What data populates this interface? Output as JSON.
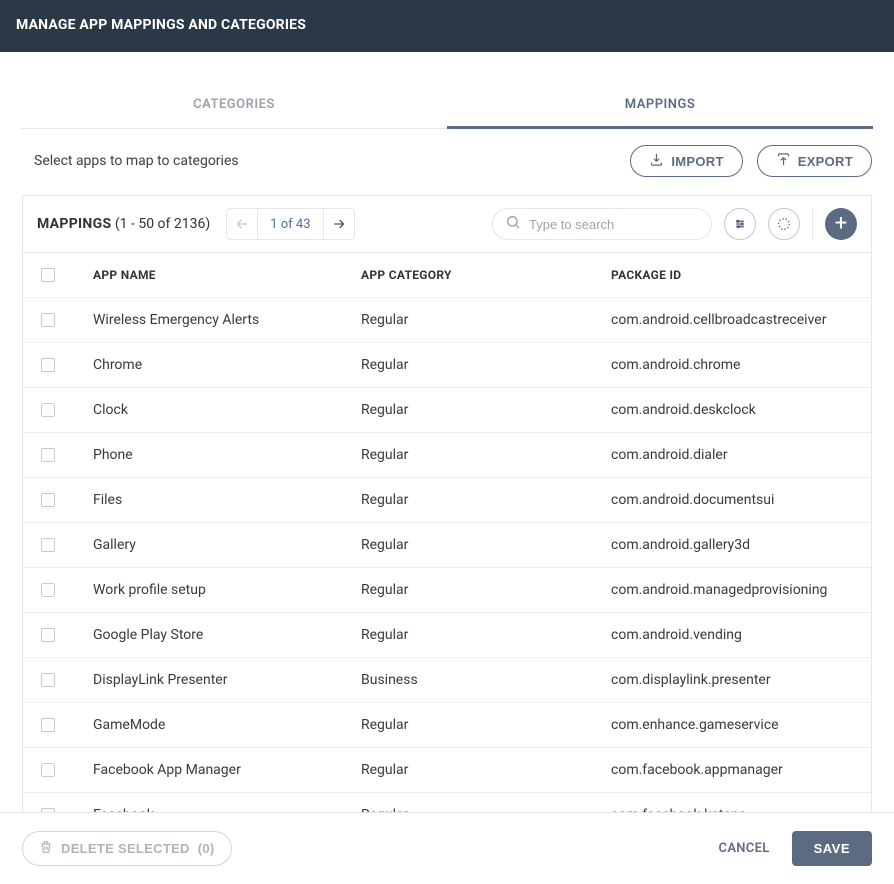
{
  "header": {
    "title": "MANAGE APP MAPPINGS AND CATEGORIES"
  },
  "tabs": {
    "categories": "CATEGORIES",
    "mappings": "MAPPINGS",
    "active": "mappings"
  },
  "instruction": "Select apps to map to categories",
  "buttons": {
    "import": "IMPORT",
    "export": "EXPORT",
    "delete_selected": "DELETE SELECTED",
    "delete_count": "(0)",
    "cancel": "CANCEL",
    "save": "SAVE"
  },
  "panel": {
    "title": "MAPPINGS",
    "range": "(1 - 50 of 2136)",
    "pager_label": "1 of 43"
  },
  "search": {
    "placeholder": "Type to search",
    "value": ""
  },
  "table": {
    "headers": {
      "name": "APP NAME",
      "category": "APP CATEGORY",
      "pkg": "PACKAGE ID"
    },
    "rows": [
      {
        "name": "Wireless Emergency Alerts",
        "category": "Regular",
        "pkg": "com.android.cellbroadcastreceiver"
      },
      {
        "name": "Chrome",
        "category": "Regular",
        "pkg": "com.android.chrome"
      },
      {
        "name": "Clock",
        "category": "Regular",
        "pkg": "com.android.deskclock"
      },
      {
        "name": "Phone",
        "category": "Regular",
        "pkg": "com.android.dialer"
      },
      {
        "name": "Files",
        "category": "Regular",
        "pkg": "com.android.documentsui"
      },
      {
        "name": "Gallery",
        "category": "Regular",
        "pkg": "com.android.gallery3d"
      },
      {
        "name": "Work profile setup",
        "category": "Regular",
        "pkg": "com.android.managedprovisioning"
      },
      {
        "name": "Google Play Store",
        "category": "Regular",
        "pkg": "com.android.vending"
      },
      {
        "name": "DisplayLink Presenter",
        "category": "Business",
        "pkg": "com.displaylink.presenter"
      },
      {
        "name": "GameMode",
        "category": "Regular",
        "pkg": "com.enhance.gameservice"
      },
      {
        "name": "Facebook App Manager",
        "category": "Regular",
        "pkg": "com.facebook.appmanager"
      },
      {
        "name": "Facebook",
        "category": "Regular",
        "pkg": "com.facebook.katana"
      }
    ]
  }
}
